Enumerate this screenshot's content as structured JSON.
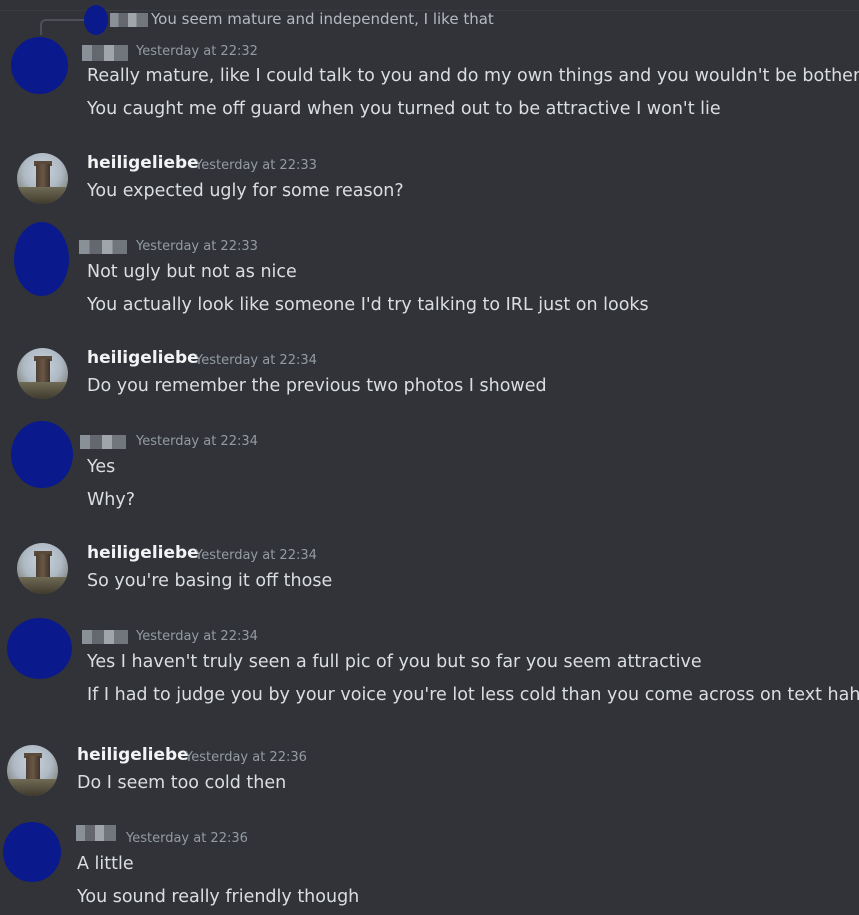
{
  "reply": {
    "text": "You seem mature and independent, I like that"
  },
  "messages": [
    {
      "author": "",
      "time": "Yesterday at 22:32",
      "lines": [
        "Really mature, like I could talk to you and do my own things and you wouldn't be bothered?",
        "You caught me off guard when you turned out to be attractive I won't lie"
      ]
    },
    {
      "author": "heiligeliebe",
      "time": "Yesterday at 22:33",
      "lines": [
        "You expected ugly for some reason?"
      ]
    },
    {
      "author": "",
      "time": "Yesterday at 22:33",
      "lines": [
        "Not ugly but not as nice",
        "You actually look like someone I'd try talking to IRL just on looks"
      ]
    },
    {
      "author": "heiligeliebe",
      "time": "Yesterday at 22:34",
      "lines": [
        "Do you remember the previous two photos I showed"
      ]
    },
    {
      "author": "",
      "time": "Yesterday at 22:34",
      "lines": [
        "Yes",
        "Why?"
      ]
    },
    {
      "author": "heiligeliebe",
      "time": "Yesterday at 22:34",
      "lines": [
        "So you're basing it off those"
      ]
    },
    {
      "author": "",
      "time": "Yesterday at 22:34",
      "lines": [
        "Yes I haven't truly seen a full pic of you but so far you seem attractive",
        "If I had to judge you by your voice you're lot less cold than you come across on text haha"
      ]
    },
    {
      "author": "heiligeliebe",
      "time": "Yesterday at 22:36",
      "lines": [
        "Do I seem too cold then"
      ]
    },
    {
      "author": "",
      "time": "Yesterday at 22:36",
      "lines": [
        "A little",
        "You sound really friendly though"
      ]
    }
  ]
}
